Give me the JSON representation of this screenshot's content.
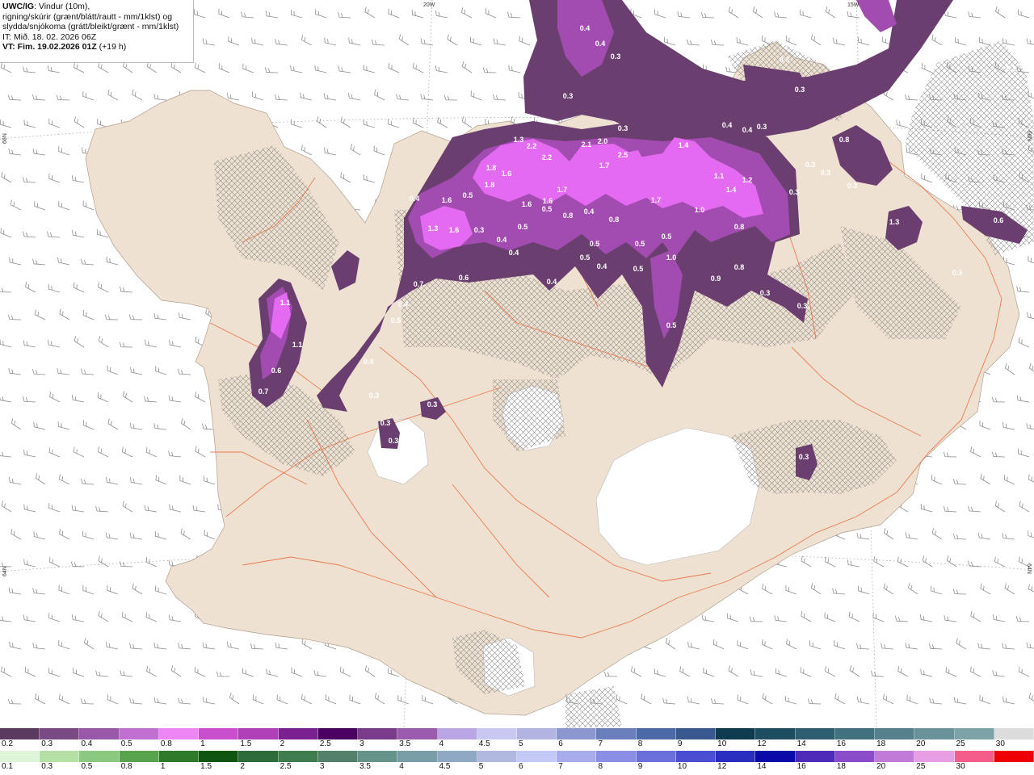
{
  "header": {
    "model_tag": "UWC/IG",
    "line1_rest": ": Vindur (10m),",
    "line2": "rigning/skúrir (grænt/blátt/rautt - mm/1klst) og",
    "line3": "slydda/snjókoma (grátt/bleikt/grænt - mm/1klst)",
    "line4": "IT: Mið. 18. 02. 2026 06Z",
    "line5_bold": "VT: Fim. 19.02.2026 01Z",
    "line5_rest": " (+19 h)"
  },
  "axes": {
    "top_20w": "20W",
    "top_15w": "15W",
    "left_66n": "66N",
    "left_64n": "64N",
    "right_66n": "66N",
    "right_64n": "64N"
  },
  "colors": {
    "sea": "#ffffff",
    "land": "#efe1d1",
    "roads": "#e9683a",
    "barbs": "#8c8c8c",
    "precip_dark": "#6a3f6f",
    "precip_mid": "#a24bb0",
    "precip_bright": "#e46af2"
  },
  "precip_labels": [
    "0.4",
    "0.4",
    "0.3",
    "0.3",
    "0.3",
    "0.6",
    "0.2",
    "0.3",
    "0.3",
    "0.5",
    "0.4",
    "0.4",
    "0.3",
    "0.3",
    "1.3",
    "2.2",
    "2.1",
    "2.0",
    "2.5",
    "1.4",
    "0.8",
    "1.8",
    "1.6",
    "2.2",
    "1.7",
    "1.1",
    "1.2",
    "0.4",
    "1.6",
    "0.5",
    "1.7",
    "1.6",
    "1.6",
    "1.4",
    "1.3",
    "0.4",
    "0.5",
    "1.8",
    "1.0",
    "0.8",
    "1.3",
    "1.6",
    "0.3",
    "0.4",
    "0.5",
    "0.5",
    "0.5",
    "1.7",
    "0.8",
    "0.8",
    "0.6",
    "0.3",
    "0.3",
    "0.3",
    "0.3",
    "0.5",
    "0.4",
    "0.5",
    "1.0",
    "0.8",
    "0.7",
    "0.6",
    "0.4",
    "0.4",
    "0.9",
    "0.3",
    "0.3",
    "0.5",
    "0.5",
    "1.1",
    "1.1",
    "0.5",
    "0.4",
    "0.6",
    "0.7",
    "0.4",
    "0.3",
    "0.3",
    "0.3",
    "0.3",
    "0.3",
    "0.3"
  ],
  "legend_snow": {
    "colors": [
      "#5a3a5e",
      "#7a4a85",
      "#9a58a8",
      "#c070d0",
      "#ee85f4",
      "#c850cc",
      "#b040b8",
      "#7a2090",
      "#4a0060",
      "#7b3b8b",
      "#9b5cb0",
      "#b9a6e2",
      "#c8c8f2",
      "#b4b4e0",
      "#8c96cf",
      "#6b7fbd",
      "#4d6aa8",
      "#3a5890",
      "#0f3b4e",
      "#1d4e60",
      "#2e5f70",
      "#41707e",
      "#55818c",
      "#69929a",
      "#7da3a8",
      "#dcdcdc"
    ],
    "labels": [
      "0.2",
      "0.3",
      "0.4",
      "0.5",
      "0.8",
      "1",
      "1.5",
      "2",
      "2.5",
      "3",
      "3.5",
      "4",
      "4.5",
      "5",
      "6",
      "7",
      "8",
      "9",
      "10",
      "12",
      "14",
      "16",
      "18",
      "20",
      "25",
      "30"
    ]
  },
  "legend_rain": {
    "colors": [
      "#dff5d8",
      "#b4e0a6",
      "#8cc980",
      "#5aa34e",
      "#2e7a2a",
      "#0f5510",
      "#2d6b3a",
      "#3f7d4f",
      "#52806a",
      "#65938a",
      "#7a9ea8",
      "#8fa8c4",
      "#b0b8e0",
      "#c4c8f4",
      "#a6acec",
      "#8a8ee4",
      "#6b6fdc",
      "#4a4ed0",
      "#2a2ec0",
      "#0a0aa8",
      "#4d2bb8",
      "#8a4cc8",
      "#c07ad8",
      "#e89ee2",
      "#f45c8a",
      "#ee0000"
    ],
    "labels": [
      "0.1",
      "0.3",
      "0.5",
      "0.8",
      "1",
      "1.5",
      "2",
      "2.5",
      "3",
      "3.5",
      "4",
      "4.5",
      "5",
      "6",
      "7",
      "8",
      "9",
      "10",
      "12",
      "14",
      "16",
      "18",
      "20",
      "25",
      "30",
      ""
    ]
  }
}
